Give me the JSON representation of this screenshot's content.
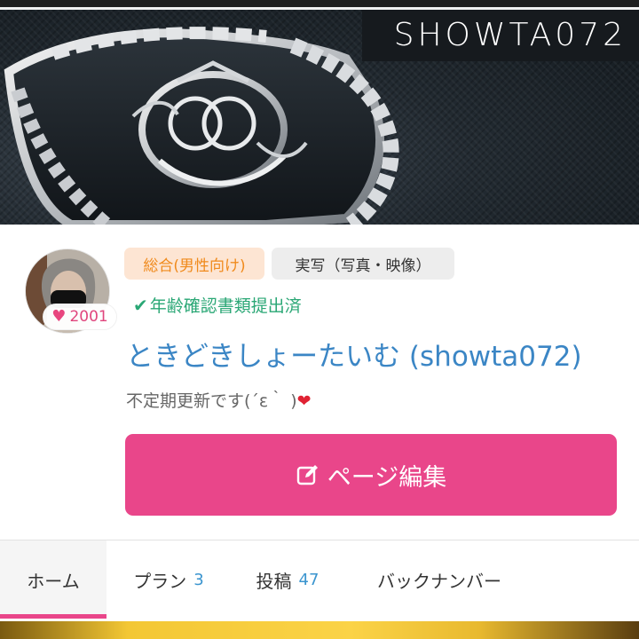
{
  "banner": {
    "title": "SHOWTA072",
    "colors": {
      "background": "#1e252b",
      "title_box": "#161a1e"
    }
  },
  "profile": {
    "avatar_icon": "avatar",
    "likes": "2001",
    "tags": [
      "総合(男性向け)",
      "実写（写真・映像）"
    ],
    "verification": "年齢確認書類提出済",
    "name": "ときどきしょーたいむ (showta072)",
    "description": "不定期更新です(´ε｀ )",
    "description_emoji": "❤"
  },
  "actions": {
    "edit_label": "ページ編集",
    "edit_icon": "edit-icon"
  },
  "tabs": [
    {
      "label": "ホーム",
      "count": ""
    },
    {
      "label": "プラン",
      "count": "3"
    },
    {
      "label": "投稿",
      "count": "47"
    },
    {
      "label": "バックナンバー",
      "count": ""
    }
  ],
  "colors": {
    "accent": "#e9468a",
    "link": "#3b86c5",
    "verified": "#2aa775",
    "tag_general_bg": "#fde5d3",
    "tag_general_fg": "#f08a1c"
  }
}
